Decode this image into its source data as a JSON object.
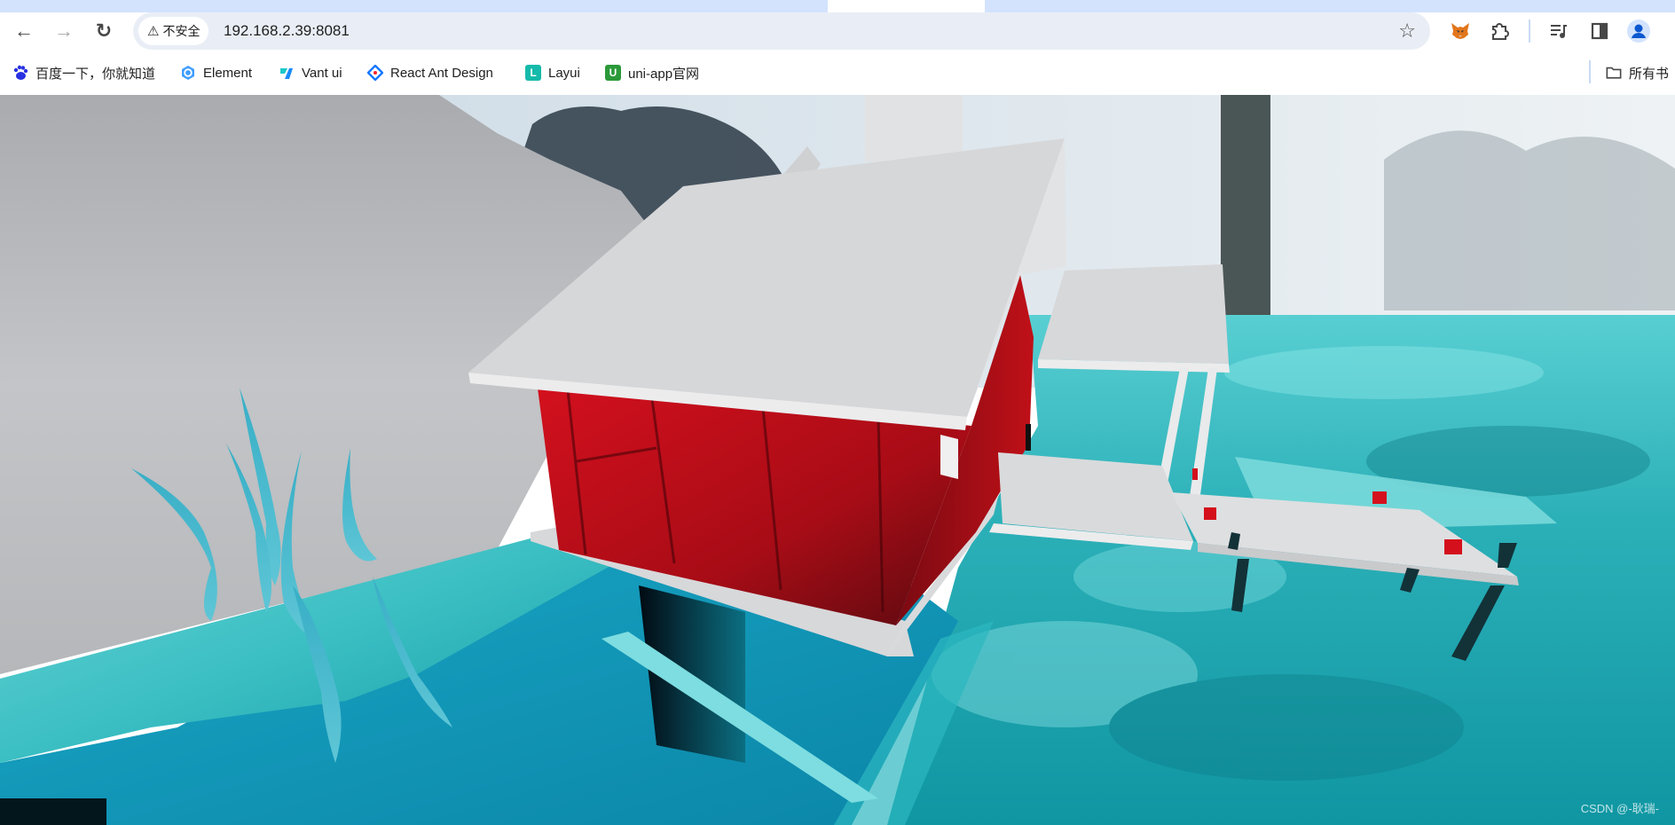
{
  "browser": {
    "nav": {
      "back_icon": "←",
      "forward_icon": "→",
      "reload_icon": "↻"
    },
    "omnibox": {
      "security_icon": "⚠",
      "security_label": "不安全",
      "url": "192.168.2.39:8081",
      "bookmark_icon": "☆"
    },
    "toolbar_icons": [
      "metamask-fox-icon",
      "extensions-puzzle-icon",
      "media-control-icon",
      "side-panel-icon",
      "profile-avatar-icon"
    ]
  },
  "bookmarks": {
    "items": [
      {
        "label": "百度一下，你就知道",
        "icon": "baidu-paw-icon",
        "color": "#2932e1"
      },
      {
        "label": "Element",
        "icon": "element-logo-icon",
        "color": "#409eff"
      },
      {
        "label": "Vant ui",
        "icon": "vant-logo-icon",
        "color": "#1bc8c8"
      },
      {
        "label": "React Ant Design",
        "icon": "ant-design-logo-icon",
        "color": "#1677ff"
      },
      {
        "label": "Layui",
        "icon": "layui-logo-icon",
        "color": "#16baaa"
      },
      {
        "label": "uni-app官网",
        "icon": "uniapp-logo-icon",
        "color": "#2b9939"
      }
    ],
    "all_bookmarks_label": "所有书"
  },
  "scene": {
    "description": "3D WebGL scene: red wooden cabin with white roof on snowy teal terrain, porch and table with red cubes",
    "colors": {
      "sky": "#e8eef2",
      "snow_hill": "#b9bbbe",
      "roof": "#d6d7d9",
      "cabin_wall": "#b3101c",
      "teal_ground": "#3fc2c6",
      "water": "#0e93b7",
      "table_leg": "#123238",
      "cube": "#d4101c"
    }
  },
  "watermark": "CSDN @-耿瑞-"
}
